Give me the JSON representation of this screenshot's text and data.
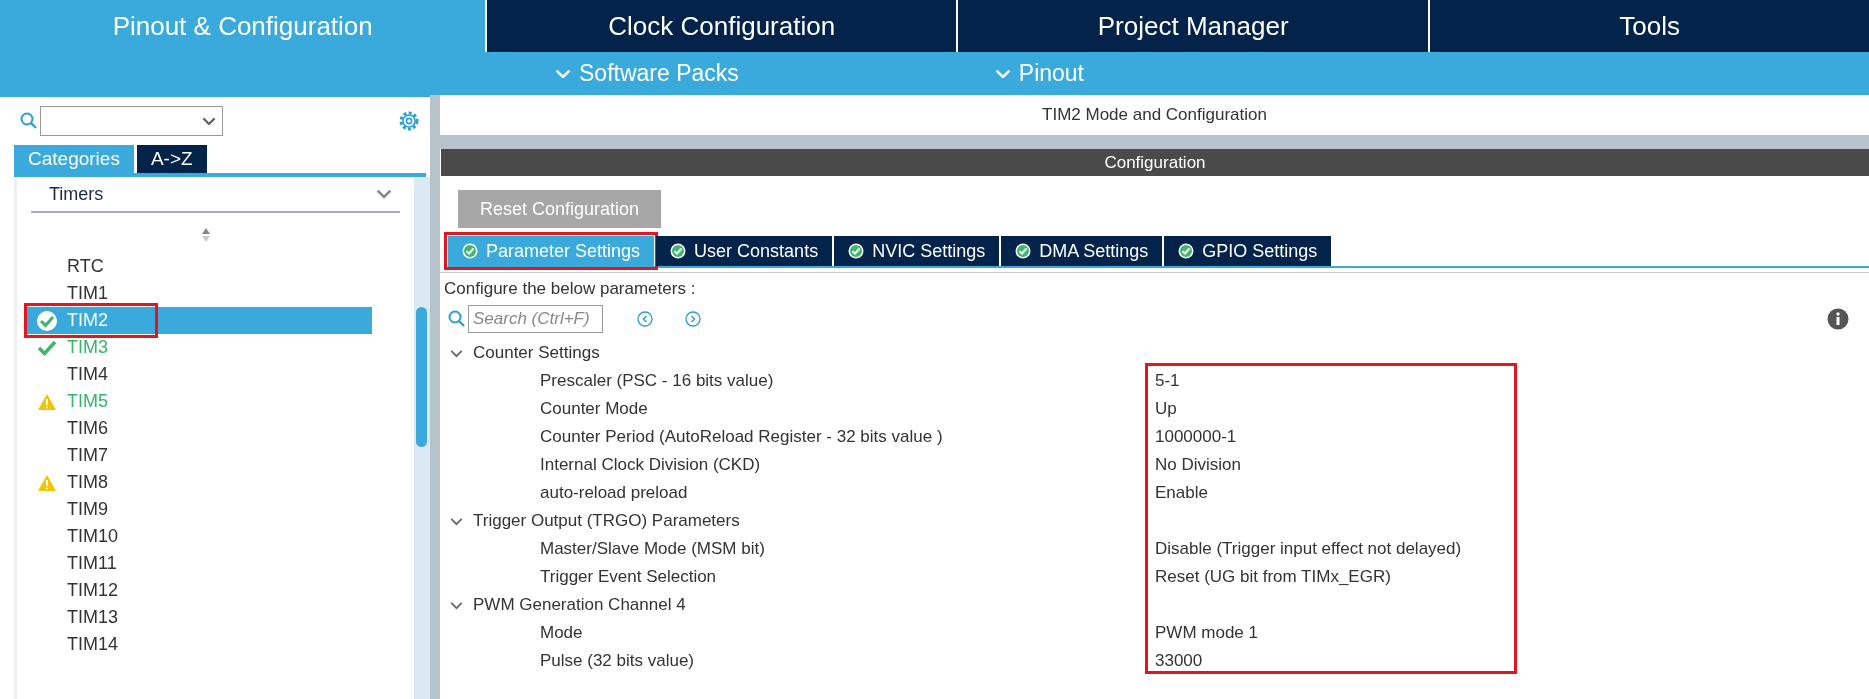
{
  "top_tabs": [
    {
      "label": "Pinout & Configuration",
      "selected": true
    },
    {
      "label": "Clock Configuration",
      "selected": false
    },
    {
      "label": "Project Manager",
      "selected": false
    },
    {
      "label": "Tools",
      "selected": false
    }
  ],
  "sub_menu": [
    "Software Packs",
    "Pinout"
  ],
  "sidebar": {
    "view_tabs": [
      {
        "label": "Categories",
        "selected": true
      },
      {
        "label": "A->Z",
        "selected": false
      }
    ],
    "category": "Timers",
    "items": [
      {
        "label": "RTC",
        "kind": "plain",
        "active": false,
        "selected": false,
        "highlighted": false
      },
      {
        "label": "TIM1",
        "kind": "plain",
        "active": false,
        "selected": false,
        "highlighted": false
      },
      {
        "label": "TIM2",
        "kind": "check",
        "active": true,
        "selected": true,
        "highlighted": true
      },
      {
        "label": "TIM3",
        "kind": "check",
        "active": true,
        "selected": false,
        "highlighted": false
      },
      {
        "label": "TIM4",
        "kind": "plain",
        "active": false,
        "selected": false,
        "highlighted": false
      },
      {
        "label": "TIM5",
        "kind": "warning",
        "active": true,
        "selected": false,
        "highlighted": false
      },
      {
        "label": "TIM6",
        "kind": "plain",
        "active": false,
        "selected": false,
        "highlighted": false
      },
      {
        "label": "TIM7",
        "kind": "plain",
        "active": false,
        "selected": false,
        "highlighted": false
      },
      {
        "label": "TIM8",
        "kind": "warning",
        "active": false,
        "selected": false,
        "highlighted": false
      },
      {
        "label": "TIM9",
        "kind": "plain",
        "active": false,
        "selected": false,
        "highlighted": false
      },
      {
        "label": "TIM10",
        "kind": "plain",
        "active": false,
        "selected": false,
        "highlighted": false
      },
      {
        "label": "TIM11",
        "kind": "plain",
        "active": false,
        "selected": false,
        "highlighted": false
      },
      {
        "label": "TIM12",
        "kind": "plain",
        "active": false,
        "selected": false,
        "highlighted": false
      },
      {
        "label": "TIM13",
        "kind": "plain",
        "active": false,
        "selected": false,
        "highlighted": false
      },
      {
        "label": "TIM14",
        "kind": "plain",
        "active": false,
        "selected": false,
        "highlighted": false
      }
    ]
  },
  "main": {
    "title": "TIM2 Mode and Configuration",
    "section": "Configuration",
    "reset_button": "Reset Configuration",
    "tabs": [
      {
        "label": "Parameter Settings",
        "selected": true,
        "highlighted": true
      },
      {
        "label": "User Constants",
        "selected": false,
        "highlighted": false
      },
      {
        "label": "NVIC Settings",
        "selected": false,
        "highlighted": false
      },
      {
        "label": "DMA Settings",
        "selected": false,
        "highlighted": false
      },
      {
        "label": "GPIO Settings",
        "selected": false,
        "highlighted": false
      }
    ],
    "hint": "Configure the below parameters :",
    "search": {
      "placeholder": "Search (Ctrl+F)"
    },
    "values_highlighted": true,
    "groups": [
      {
        "label": "Counter Settings",
        "expanded": true,
        "params": [
          {
            "name": "Prescaler (PSC - 16 bits value)",
            "value": "5-1"
          },
          {
            "name": "Counter Mode",
            "value": "Up"
          },
          {
            "name": "Counter Period (AutoReload Register - 32 bits value )",
            "value": "1000000-1"
          },
          {
            "name": "Internal Clock Division (CKD)",
            "value": "No Division"
          },
          {
            "name": "auto-reload preload",
            "value": "Enable"
          }
        ]
      },
      {
        "label": "Trigger Output (TRGO) Parameters",
        "expanded": true,
        "params": [
          {
            "name": "Master/Slave Mode (MSM bit)",
            "value": "Disable (Trigger input effect not delayed)"
          },
          {
            "name": "Trigger Event Selection",
            "value": "Reset (UG bit from TIMx_EGR)"
          }
        ]
      },
      {
        "label": "PWM Generation Channel 4",
        "expanded": true,
        "params": [
          {
            "name": "Mode",
            "value": "PWM mode 1"
          },
          {
            "name": "Pulse (32 bits value)",
            "value": "33000"
          }
        ]
      }
    ]
  }
}
